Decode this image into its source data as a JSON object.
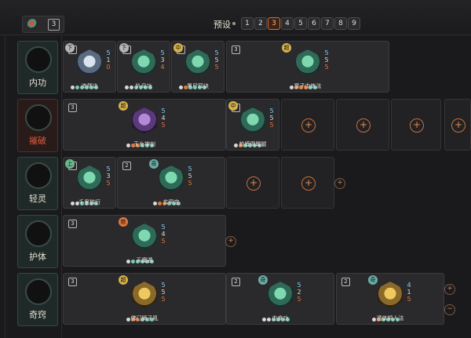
{
  "top": {
    "counter": "3",
    "preset_label": "预设",
    "presets": [
      "1",
      "2",
      "3",
      "4",
      "5",
      "6",
      "7",
      "8",
      "9"
    ],
    "active_preset": "3"
  },
  "categories": [
    {
      "label": "内功",
      "style": "normal"
    },
    {
      "label": "摧破",
      "style": "red"
    },
    {
      "label": "轻灵",
      "style": "normal"
    },
    {
      "label": "护体",
      "style": "normal"
    },
    {
      "label": "奇窍",
      "style": "normal"
    }
  ],
  "rows": {
    "neigong": [
      {
        "name": "沛然诀",
        "rank": "1",
        "grade": "下",
        "stats": [
          "5",
          "1",
          "0"
        ],
        "icon": "white"
      },
      {
        "name": "扒母功",
        "rank": "1",
        "grade": "下",
        "stats": [
          "5",
          "3",
          "4"
        ],
        "icon": "teal"
      },
      {
        "name": "黑尸四诀",
        "rank": "1",
        "grade": "中",
        "stats": [
          "5",
          "5",
          "5"
        ],
        "icon": "teal"
      },
      {
        "name": "童子血练法",
        "rank": "3",
        "grade": "超",
        "stats": [
          "5",
          "5",
          "5"
        ],
        "icon": "teal"
      }
    ],
    "cuipo": [
      {
        "name": "玉女神剑",
        "rank": "3",
        "grade": "超",
        "stats": [
          "5",
          "4",
          "5"
        ],
        "icon": "purple"
      },
      {
        "name": "蛤蟆倒踢腿",
        "rank": "1",
        "grade": "中",
        "stats": [
          "5",
          "5",
          "5"
        ],
        "icon": "teal"
      }
    ],
    "qingling": [
      {
        "name": "千里独行",
        "rank": "1",
        "grade": "上",
        "stats": [
          "5",
          "3",
          "5"
        ],
        "icon": "teal"
      },
      {
        "name": "玄甲定",
        "rank": "2",
        "grade": "奇",
        "stats": [
          "5",
          "5",
          "5"
        ],
        "icon": "teal"
      }
    ],
    "huti": [
      {
        "name": "天魔遁",
        "rank": "3",
        "grade": "绝",
        "stats": [
          "5",
          "4",
          "5"
        ],
        "icon": "teal"
      }
    ],
    "qiqiao": [
      {
        "name": "佛门狮子吼",
        "rank": "3",
        "grade": "超",
        "stats": [
          "5",
          "5",
          "5"
        ],
        "icon": "gold"
      },
      {
        "name": "血食功",
        "rank": "2",
        "grade": "奇",
        "stats": [
          "5",
          "2",
          "5"
        ],
        "icon": "teal"
      },
      {
        "name": "遁体铜人法",
        "rank": "2",
        "grade": "奇",
        "stats": [
          "4",
          "1",
          "5"
        ],
        "icon": "gold"
      }
    ]
  },
  "empty_slot_glyph": "+",
  "remove_glyph": "−",
  "icons": {
    "top_emblem": "yin-yang-emblem-icon",
    "category": "category-emblem-icon",
    "add": "plus-icon",
    "remove": "minus-icon"
  },
  "colors": {
    "accent": "#e06a2a",
    "teal": "#7ac8b8",
    "gold": "#d6b24a"
  }
}
